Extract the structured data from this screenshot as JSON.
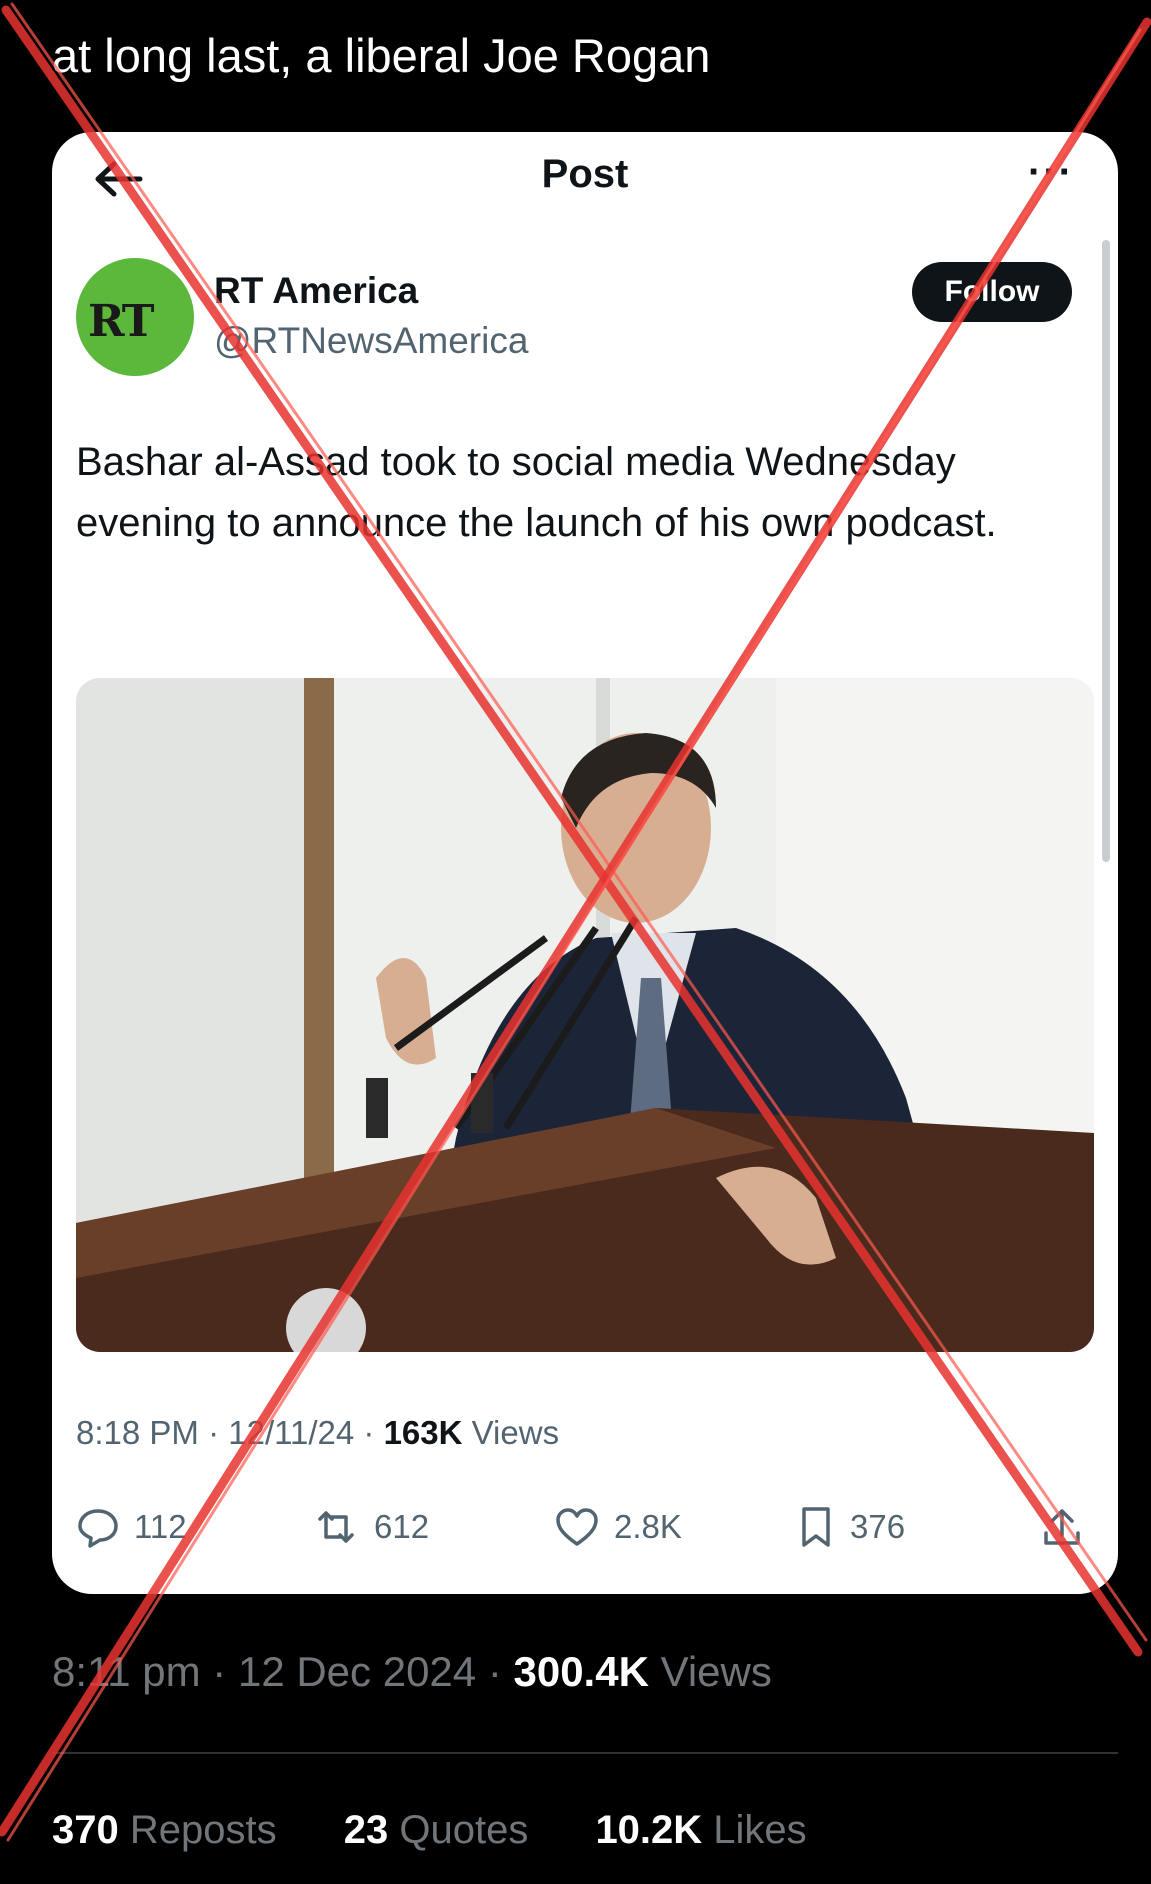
{
  "caption": "at long last, a liberal Joe Rogan",
  "embedded_post": {
    "topbar": {
      "title": "Post",
      "back_icon": "arrow-left-icon",
      "more_label": "···"
    },
    "author": {
      "display_name": "RT America",
      "handle": "@RTNewsAmerica",
      "avatar_text": "RT",
      "avatar_color": "#5bb83a"
    },
    "follow_label": "Follow",
    "text": "Bashar al-Assad took to social media Wednesday evening to announce the launch of his own podcast.",
    "meta": {
      "time": "8:18 PM",
      "separator": " · ",
      "date": "12/11/24",
      "views_count": "163K",
      "views_label": " Views"
    },
    "actions": {
      "replies": "112",
      "reposts": "612",
      "likes": "2.8K",
      "bookmarks": "376"
    }
  },
  "outer_meta": {
    "time": "8:11 pm",
    "separator": " · ",
    "date": "12 Dec 2024",
    "views_count": "300.4K",
    "views_label": " Views"
  },
  "stats": {
    "reposts_count": "370",
    "reposts_label": " Reposts",
    "quotes_count": "23",
    "quotes_label": " Quotes",
    "likes_count": "10.2K",
    "likes_label": " Likes"
  },
  "colors": {
    "strike_x": "#e8332f",
    "follow_bg": "#0f1419",
    "muted": "#536471"
  }
}
